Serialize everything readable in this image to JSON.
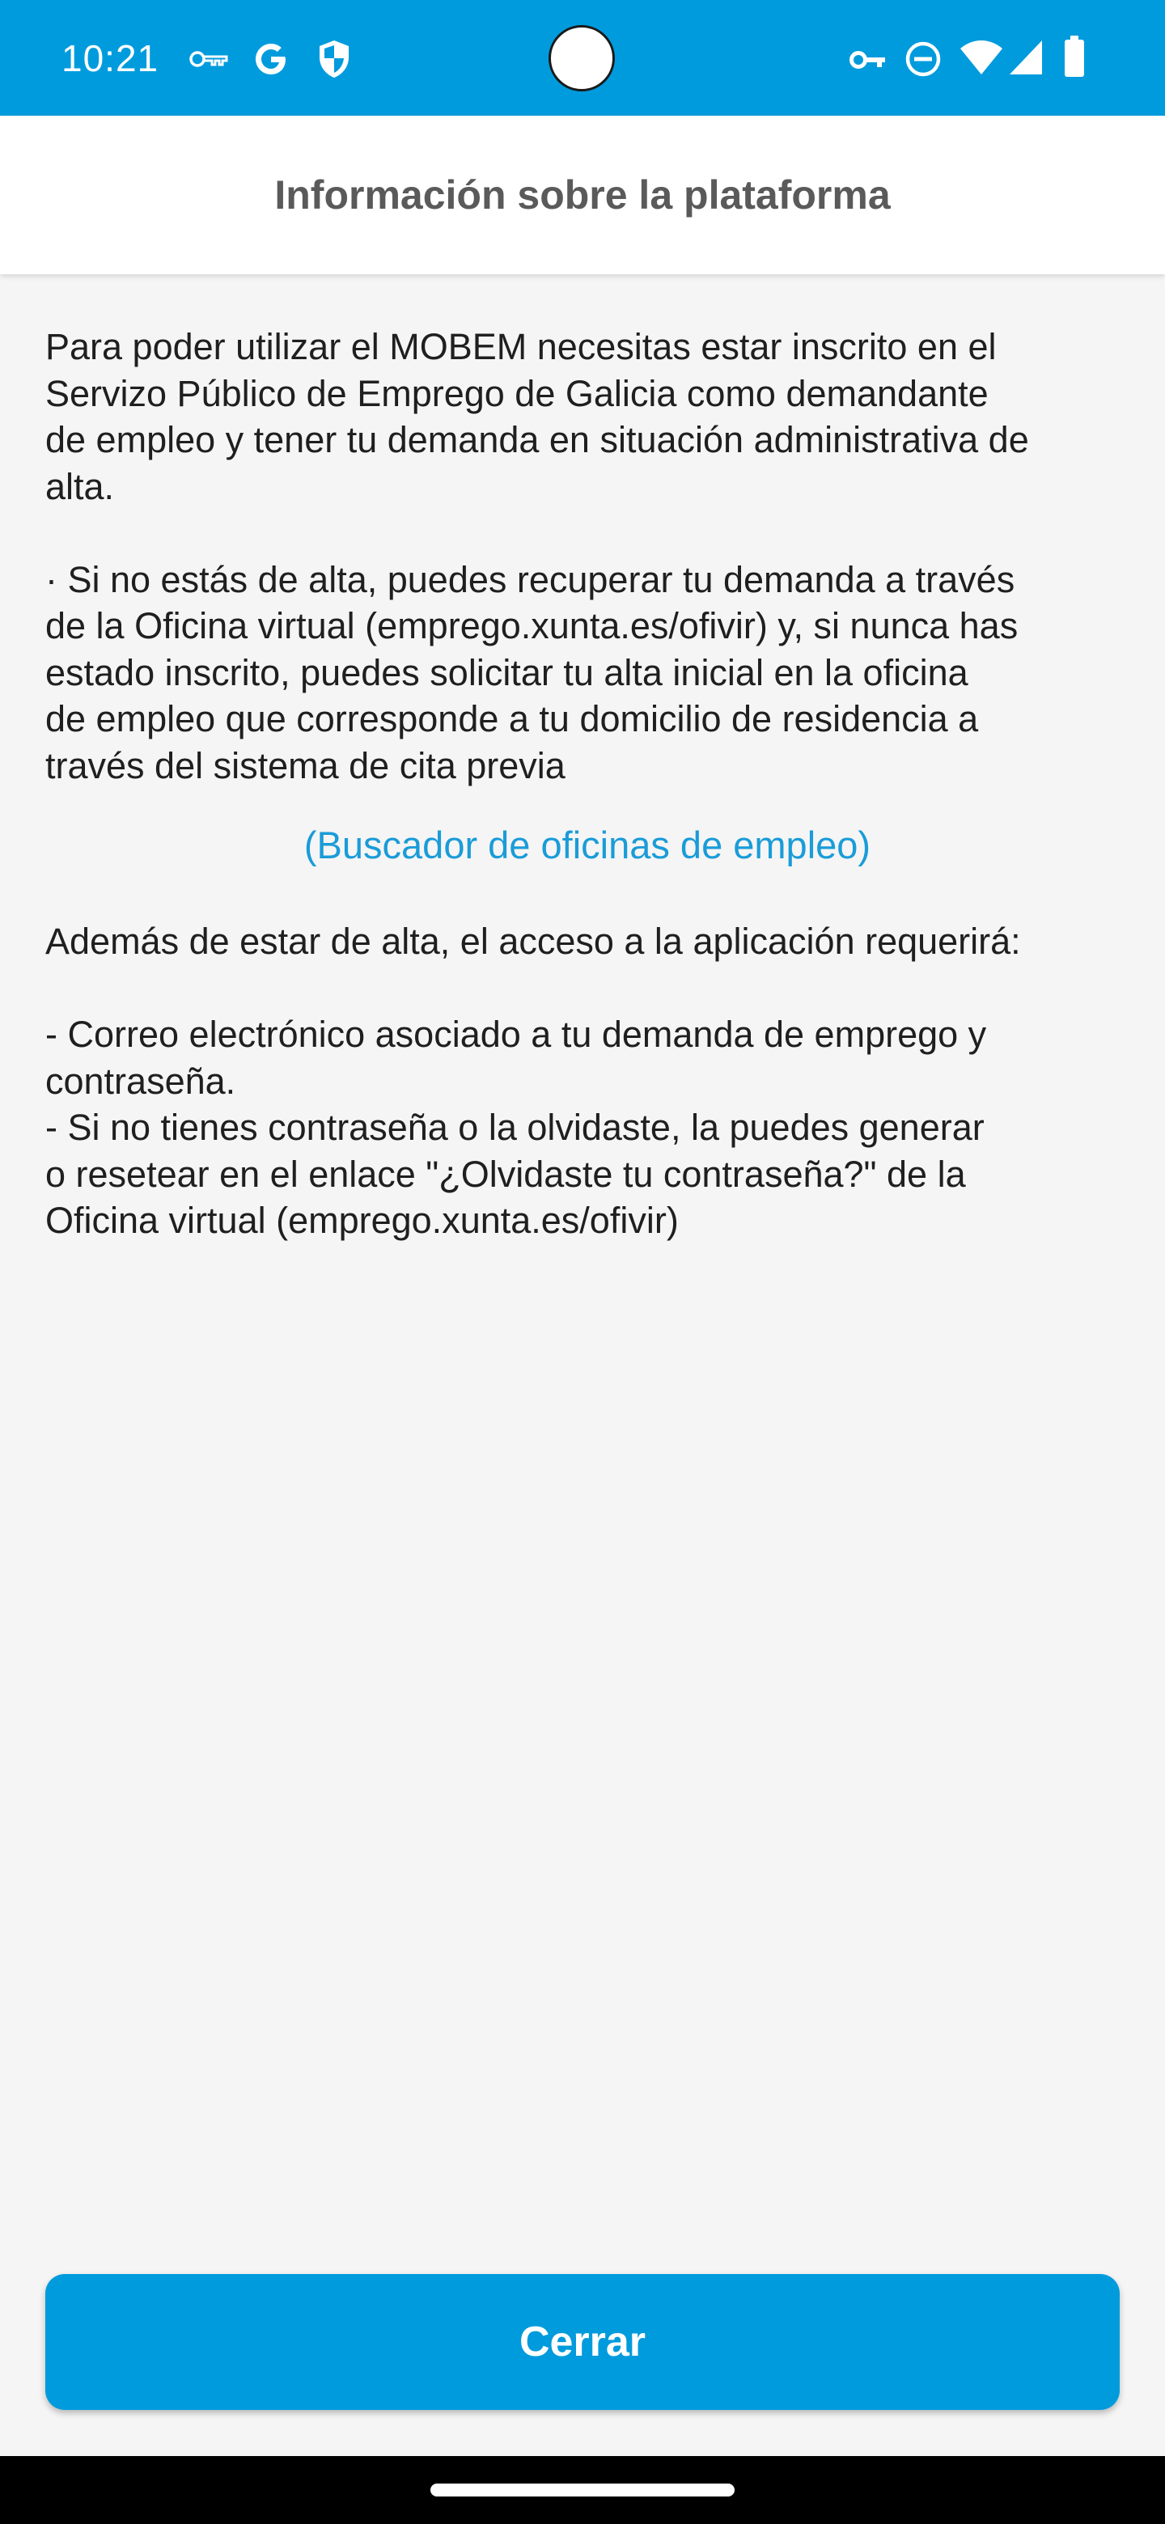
{
  "status_bar": {
    "time": "10:21",
    "left_icons": [
      "key-icon",
      "google-icon",
      "shield-icon"
    ],
    "right_icons": [
      "vpn-key-icon",
      "do-not-disturb-icon",
      "wifi-icon",
      "signal-icon",
      "battery-icon"
    ]
  },
  "app_bar": {
    "title": "Información sobre la plataforma"
  },
  "content": {
    "intro": "Para poder utilizar el MOBEM necesitas estar inscrito en el\nServizo Público de Emprego de Galicia como demandante\nde empleo y tener tu demanda en situación administrativa de\nalta.",
    "alta_info": "· Si no estás de alta, puedes recuperar tu demanda a través\nde la Oficina virtual (emprego.xunta.es/ofivir) y, si nunca has\nestado inscrito, puedes solicitar tu alta inicial en la oficina\nde empleo que corresponde a tu domicilio de residencia a\ntravés del sistema de cita previa",
    "office_link": "(Buscador de oficinas de empleo)",
    "requirements_intro": "Además de estar de alta, el acceso a la aplicación requerirá:",
    "requirement_email": "- Correo electrónico asociado a tu demanda de emprego y\ncontraseña.",
    "requirement_password": "- Si no tienes contraseña o la olvidaste, la puedes generar\no resetear en el enlace \"¿Olvidaste tu contraseña?\" de la\nOficina virtual (emprego.xunta.es/ofivir)"
  },
  "actions": {
    "close_label": "Cerrar"
  },
  "colors": {
    "accent": "#009bdd",
    "link": "#1a9cd8",
    "background": "#f5f5f5",
    "title": "#5a5a5a",
    "text": "#1f1f1f"
  }
}
